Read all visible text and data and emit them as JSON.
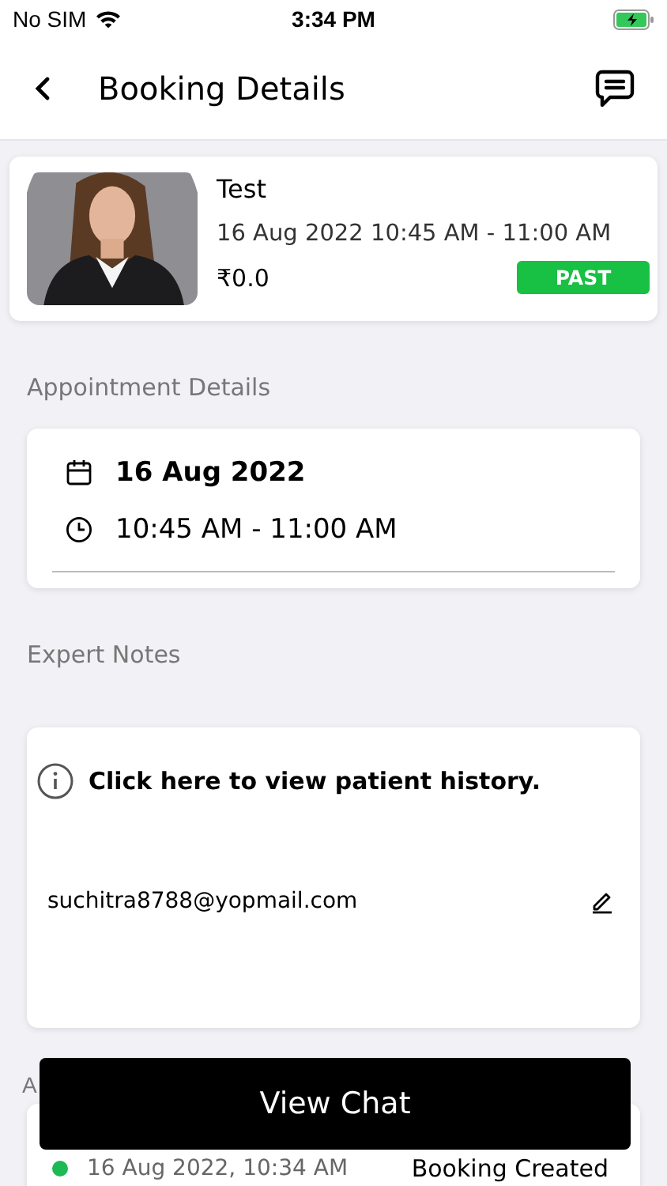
{
  "status_bar": {
    "carrier": "No SIM",
    "time": "3:34 PM",
    "charging": true
  },
  "header": {
    "title": "Booking Details"
  },
  "booking": {
    "name": "Test",
    "datetime": "16 Aug 2022 10:45 AM - 11:00 AM",
    "price": "₹0.0",
    "status": {
      "label": "PAST",
      "kind": "past"
    }
  },
  "appointment": {
    "heading": "Appointment Details",
    "date": "16 Aug 2022",
    "time": "10:45 AM - 11:00 AM"
  },
  "notes": {
    "heading": "Expert Notes",
    "history_link": "Click here to view patient history.",
    "email": "suchitra8788@yopmail.com"
  },
  "activity": {
    "heading": "A",
    "items": [
      {
        "time": "16 Aug 2022, 10:34 AM",
        "label": "Booking Created",
        "color": "#1db954"
      }
    ]
  },
  "view_chat_button": "View Chat"
}
